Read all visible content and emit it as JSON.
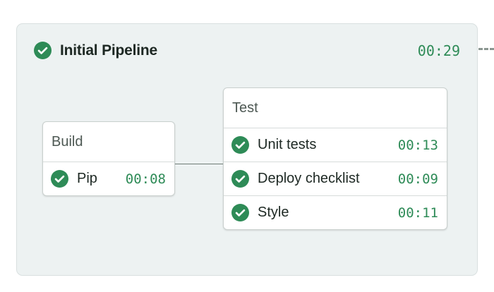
{
  "pipeline": {
    "title": "Initial Pipeline",
    "duration": "00:29",
    "status": "passed"
  },
  "blocks": [
    {
      "title": "Build",
      "jobs": [
        {
          "name": "Pip",
          "duration": "00:08",
          "status": "passed"
        }
      ]
    },
    {
      "title": "Test",
      "jobs": [
        {
          "name": "Unit tests",
          "duration": "00:13",
          "status": "passed"
        },
        {
          "name": "Deploy checklist",
          "duration": "00:09",
          "status": "passed"
        },
        {
          "name": "Style",
          "duration": "00:11",
          "status": "passed"
        }
      ]
    }
  ],
  "icons": {
    "status": "check-circle-icon"
  },
  "colors": {
    "success": "#2e8b57",
    "panel_bg": "#edf2f2",
    "duration_text": "#2e8b57"
  }
}
